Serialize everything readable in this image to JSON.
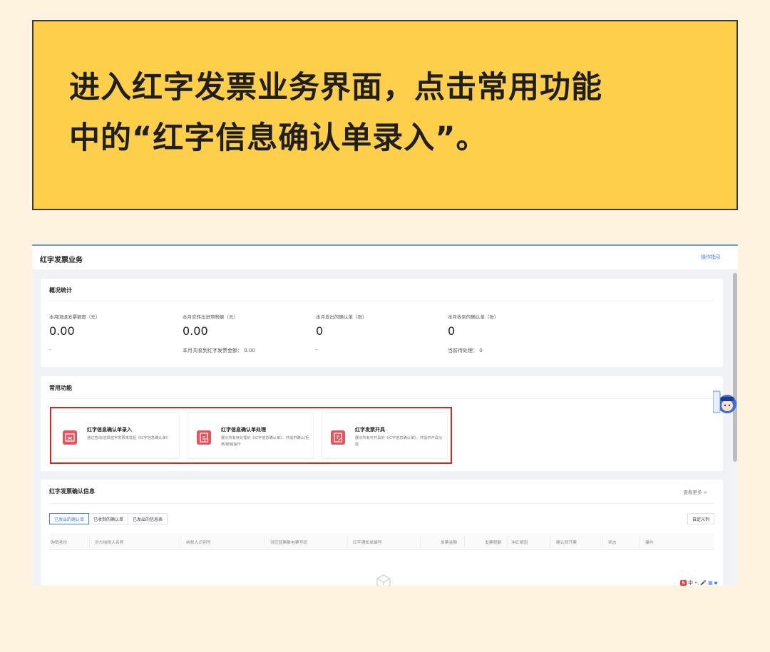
{
  "banner": {
    "line1": "进入红字发票业务界面，点击常用功能",
    "line2": "中的“红字信息确认单录入”。"
  },
  "app": {
    "title": "红字发票业务",
    "guide_link": "操作指引"
  },
  "overview": {
    "title": "概况统计",
    "stats": [
      {
        "label": "本月回退发票额度（元）",
        "value": "0.00",
        "sub": "-"
      },
      {
        "label": "本月应转出进项税额（元）",
        "value": "0.00",
        "sub": "本月共收到红字发票金额： 0.00"
      },
      {
        "label": "本月发出的确认单（张）",
        "value": "0",
        "sub": "-"
      },
      {
        "label": "本月收到的确认单（张）",
        "value": "0",
        "sub": "当前待处理： 0"
      }
    ]
  },
  "functions": {
    "title": "常用功能",
    "items": [
      {
        "name": "红字信息确认单录入",
        "desc": "通过查询/选择蓝字发票来发起《红字信息确认单》",
        "icon": "swap-icon"
      },
      {
        "name": "红字信息确认单处理",
        "desc": "展示所有待处理的《红字信息确认单》，并提供确认/拒绝/撤销操作",
        "icon": "document-edit-icon"
      },
      {
        "name": "红字发票开具",
        "desc": "展示所有可开具的《红字信息确认单》，并提供开具功能",
        "icon": "invoice-issue-icon"
      }
    ],
    "highlight_color": "#d9251d"
  },
  "confirm_info": {
    "title": "红字发票确认信息",
    "more_link": "查看更多 >",
    "tabs": [
      "已发出的确认单",
      "已收到的确认单",
      "已发出的信息表"
    ],
    "active_tab": "已发出的确认单",
    "custom_columns_button": "自定义列",
    "columns": [
      "购销身份",
      "对方纳税人名称",
      "纳税人识别号",
      "对应蓝票数电票号码",
      "红字通知单编号",
      "发票金额",
      "发票税额",
      "冲红原因",
      "确认即开票",
      "状态",
      "操作"
    ]
  },
  "ime": {
    "logo": "S",
    "lang": "中"
  },
  "colors": {
    "banner_bg": "#fecf4a",
    "page_bg": "#fdf3de",
    "accent_blue": "#3c7cf0",
    "icon_red": "#e8525a"
  }
}
